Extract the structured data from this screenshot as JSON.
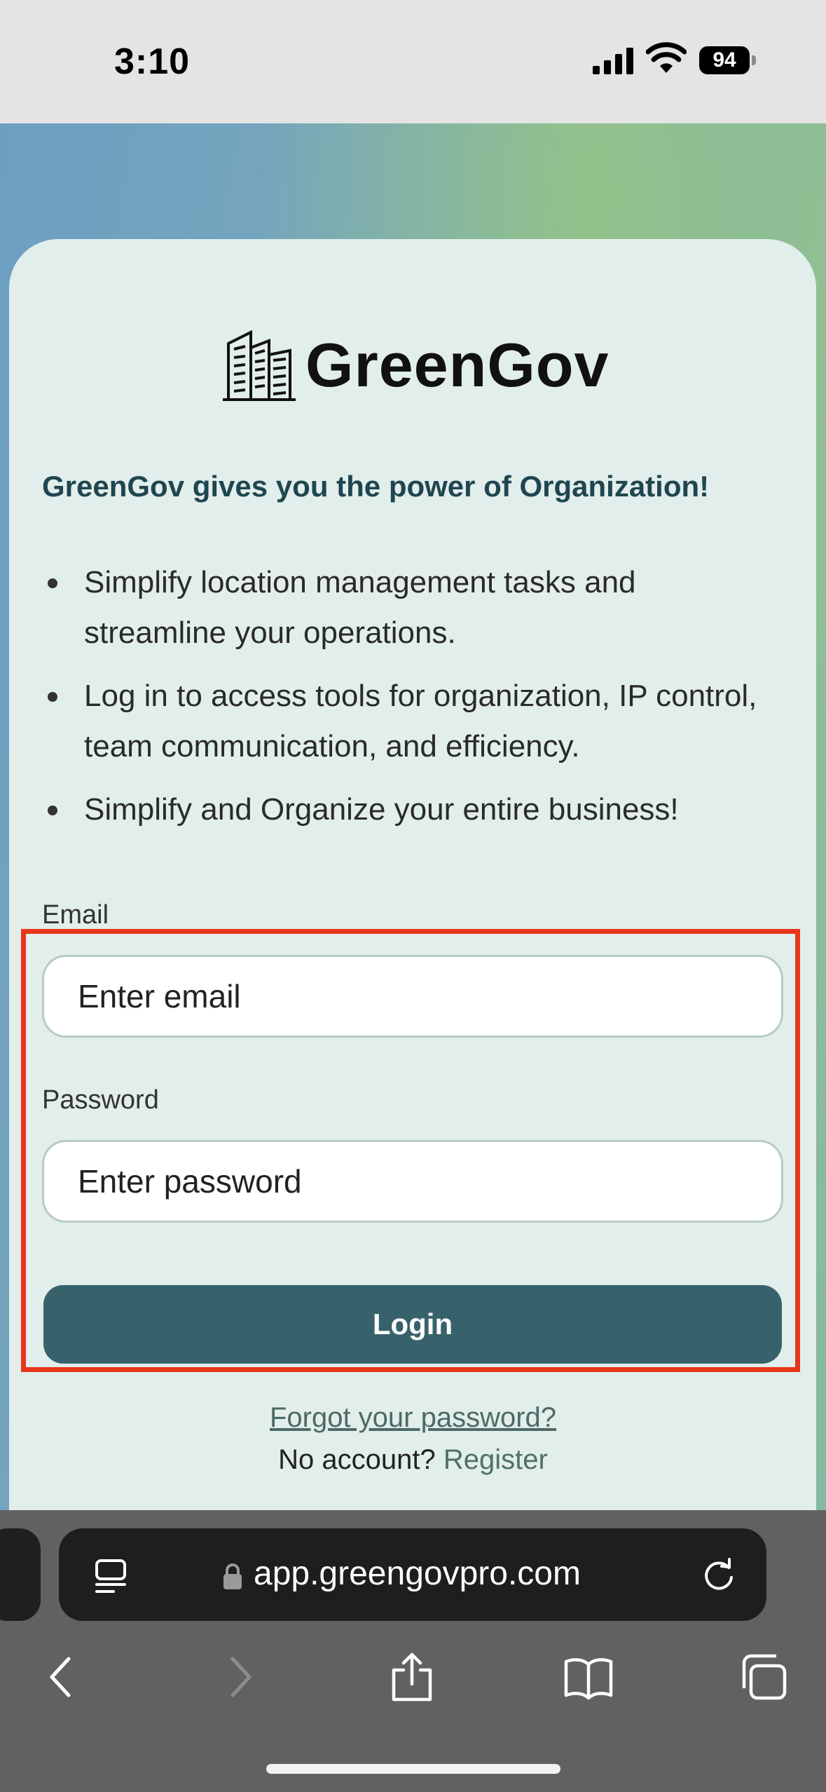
{
  "status_bar": {
    "time": "3:10",
    "battery_level": "94"
  },
  "brand": {
    "name": "GreenGov",
    "logo_icon": "building-icon"
  },
  "tagline": "GreenGov gives you the power of Organization!",
  "features": [
    "Simplify location management tasks and streamline your operations.",
    "Log in to access tools for organization, IP control, team communication, and efficiency.",
    "Simplify and Organize your entire business!"
  ],
  "form": {
    "email_label": "Email",
    "email_placeholder": "Enter email",
    "email_value": "",
    "password_label": "Password",
    "password_placeholder": "Enter password",
    "password_value": "",
    "login_label": "Login",
    "highlight_color": "#e8361c"
  },
  "links": {
    "forgot_password": "Forgot your password?",
    "no_account": "No account?",
    "register": "Register"
  },
  "browser": {
    "url": "app.greengovpro.com",
    "icons": [
      "tab-overview-icon",
      "lock-icon",
      "reload-icon",
      "back-icon",
      "forward-icon",
      "share-icon",
      "bookmarks-icon",
      "tabs-icon"
    ]
  },
  "colors": {
    "primary_button": "#37626b",
    "card_background": "#e2eeeb",
    "tagline": "#1f4650"
  }
}
